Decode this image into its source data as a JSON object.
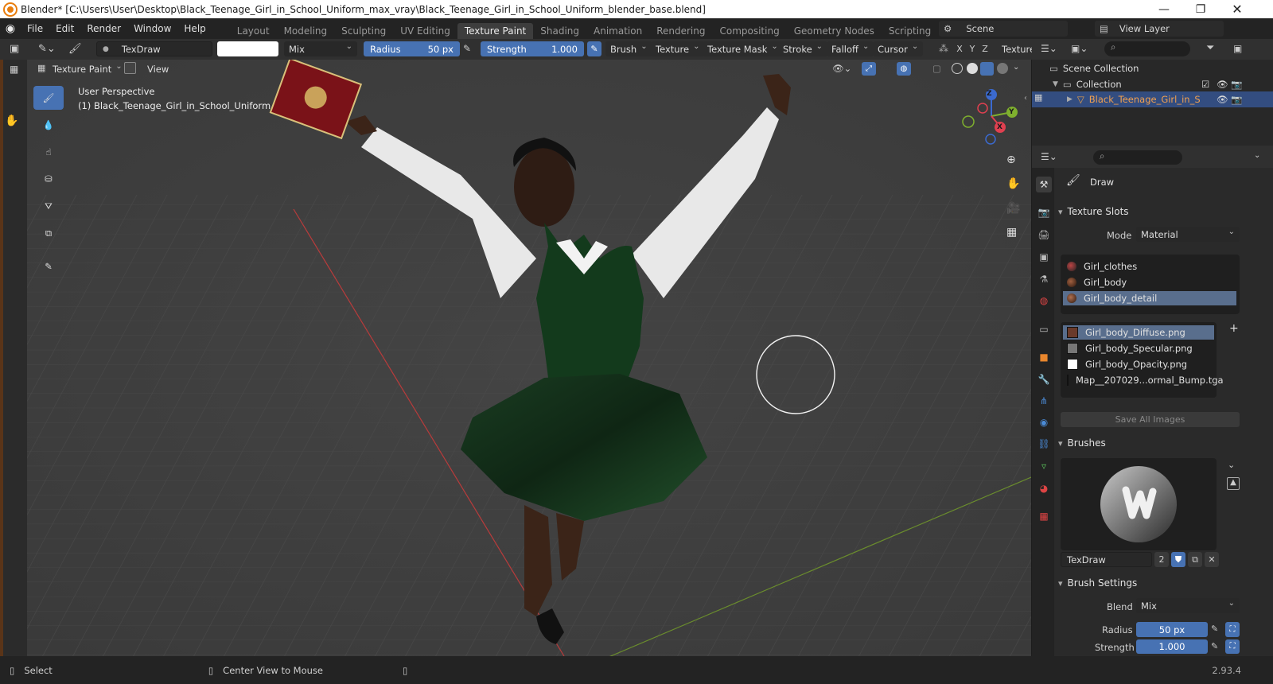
{
  "window": {
    "title": "Blender* [C:\\Users\\User\\Desktop\\Black_Teenage_Girl_in_School_Uniform_max_vray\\Black_Teenage_Girl_in_School_Uniform_blender_base.blend]"
  },
  "menu": [
    "File",
    "Edit",
    "Render",
    "Window",
    "Help"
  ],
  "workspaces": [
    "Layout",
    "Modeling",
    "Sculpting",
    "UV Editing",
    "Texture Paint",
    "Shading",
    "Animation",
    "Rendering",
    "Compositing",
    "Geometry Nodes",
    "Scripting"
  ],
  "active_workspace_index": 4,
  "scene": {
    "name": "Scene",
    "view_layer": "View Layer"
  },
  "tool_header": {
    "brush_name": "TexDraw",
    "blend": "Mix",
    "radius_label": "Radius",
    "radius_value": "50 px",
    "strength_label": "Strength",
    "strength_value": "1.000",
    "menus": [
      "Brush",
      "Texture",
      "Texture Mask",
      "Stroke",
      "Falloff",
      "Cursor"
    ],
    "axes": [
      "X",
      "Y",
      "Z"
    ],
    "texture_label": "Texture"
  },
  "viewport_header": {
    "mode": "Texture Paint",
    "view": "View"
  },
  "viewport": {
    "perspective": "User Perspective",
    "object": "(1) Black_Teenage_Girl_in_School_Uniform",
    "gizmo": {
      "y": "Y",
      "z": "Z",
      "x": "X"
    }
  },
  "outliner": {
    "scene_collection": "Scene Collection",
    "collection": "Collection",
    "object": "Black_Teenage_Girl_in_S"
  },
  "properties": {
    "tool_name": "Draw",
    "texture_slots": {
      "title": "Texture Slots",
      "mode_label": "Mode",
      "mode_value": "Material",
      "materials": [
        "Girl_clothes",
        "Girl_body",
        "Girl_body_detail"
      ],
      "images": [
        "Girl_body_Diffuse.png",
        "Girl_body_Specular.png",
        "Girl_body_Opacity.png",
        "Map__207029...ormal_Bump.tga"
      ],
      "save_all": "Save All Images"
    },
    "brushes": {
      "title": "Brushes",
      "brush": "TexDraw",
      "users": "2"
    },
    "brush_settings": {
      "title": "Brush Settings",
      "blend_label": "Blend",
      "blend_value": "Mix",
      "radius_label": "Radius",
      "radius_value": "50 px",
      "strength_label": "Strength",
      "strength_value": "1.000"
    }
  },
  "status_bar": {
    "select": "Select",
    "center": "Center View to Mouse",
    "version": "2.93.4"
  },
  "colors": {
    "accent": "#4772b3",
    "orange": "#e87d0d",
    "uniform_green": "#1d4a26"
  }
}
